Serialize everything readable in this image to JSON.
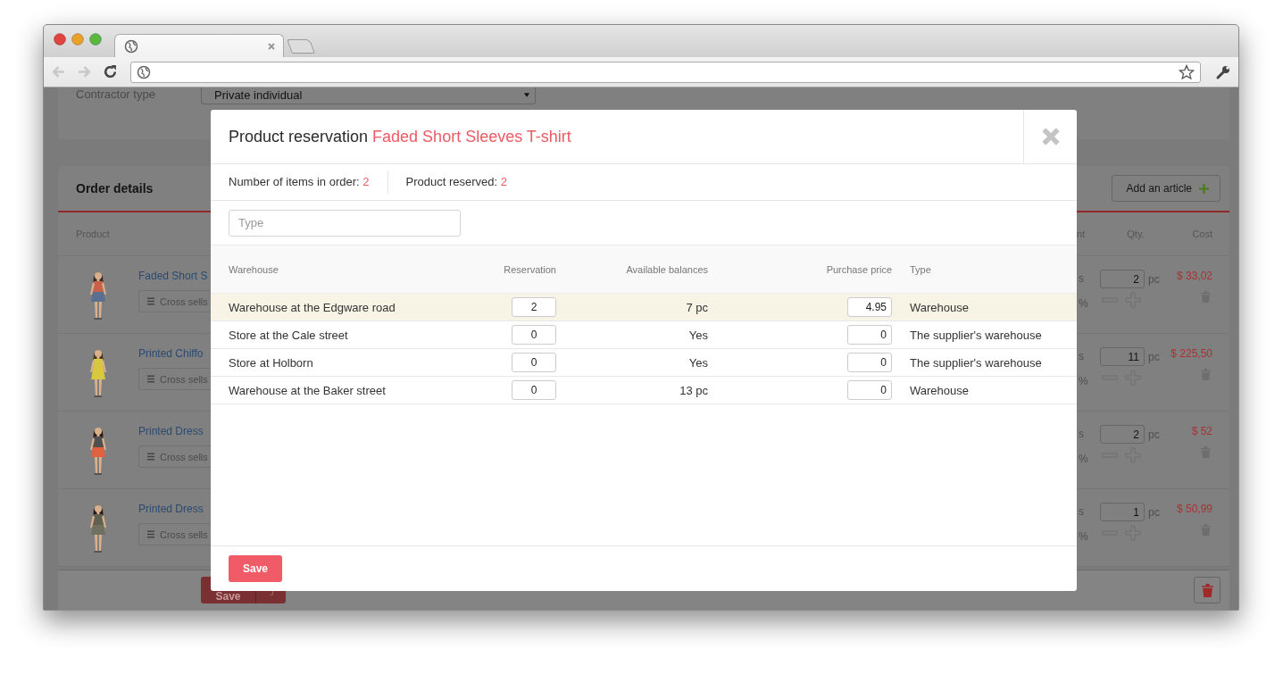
{
  "page": {
    "contractor_type": {
      "label": "Contractor type",
      "value": "Private individual"
    },
    "order_details": {
      "title": "Order details",
      "add_button": "Add an article",
      "columns": [
        "Product",
        "nt",
        "Qty.",
        "Cost"
      ],
      "rows": [
        {
          "product": "Faded Short S",
          "cross_sells": "Cross sells",
          "column_3a": "s",
          "column_3b": "%",
          "qty": "2",
          "unit": "pc",
          "cost": "$ 33,02"
        },
        {
          "product": "Printed Chiffo",
          "cross_sells": "Cross sells",
          "column_3a": "s",
          "column_3b": "%",
          "qty": "11",
          "unit": "pc",
          "cost": "$ 225,50"
        },
        {
          "product": "Printed Dress",
          "cross_sells": "Cross sells",
          "column_3a": "s",
          "column_3b": "%",
          "qty": "2",
          "unit": "pc",
          "cost": "$ 52"
        },
        {
          "product": "Printed Dress",
          "cross_sells": "Cross sells",
          "column_3a": "s",
          "column_3b": "%",
          "qty": "1",
          "unit": "pc",
          "cost": "$ 50,99"
        }
      ]
    },
    "footer": {
      "save": "Save"
    }
  },
  "modal": {
    "title": "Product reservation",
    "product": "Faded Short Sleeves T-shirt",
    "stats": [
      {
        "label": "Number of items in order:",
        "value": "2"
      },
      {
        "label": "Product reserved:",
        "value": "2"
      }
    ],
    "filter": {
      "placeholder": "Type"
    },
    "columns": [
      "Warehouse",
      "Reservation",
      "Available balances",
      "Purchase price",
      "Type"
    ],
    "rows": [
      {
        "warehouse": "Warehouse at the Edgware road",
        "reservation": "2",
        "available": "7 pc",
        "price": "4.95",
        "type": "Warehouse",
        "selected": true
      },
      {
        "warehouse": "Store at the Cale street",
        "reservation": "0",
        "available": "Yes",
        "price": "0",
        "type": "The supplier's warehouse",
        "selected": false
      },
      {
        "warehouse": "Store at Holborn",
        "reservation": "0",
        "available": "Yes",
        "price": "0",
        "type": "The supplier's warehouse",
        "selected": false
      },
      {
        "warehouse": "Warehouse at the Baker street",
        "reservation": "0",
        "available": "13 pc",
        "price": "0",
        "type": "Warehouse",
        "selected": false
      }
    ],
    "save": "Save"
  }
}
